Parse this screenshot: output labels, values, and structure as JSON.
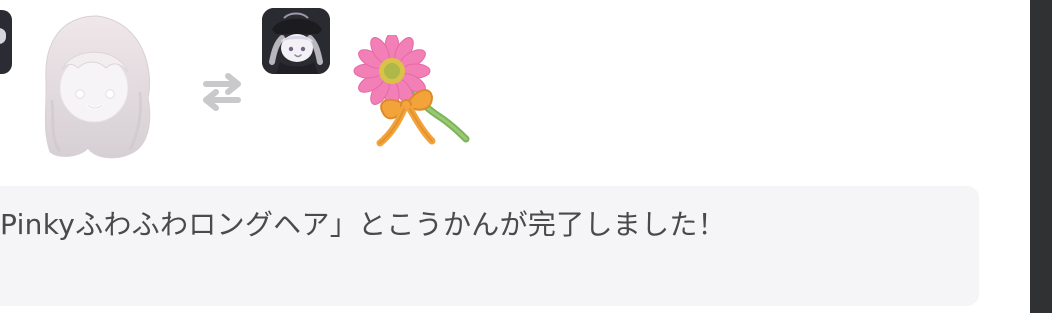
{
  "notification": {
    "message": "Pinkyふわふわロングヘア」とこうかんが完了しました！"
  },
  "icons": {
    "left_avatar": "user-avatar-icon",
    "hair": "long-wavy-hair-item-icon",
    "swap": "swap-arrows-icon",
    "small_avatar": "traded-avatar-icon",
    "flower": "flower-gift-icon"
  },
  "colors": {
    "message_bg": "#f5f5f7",
    "message_text": "#4a4a4a",
    "swap_icon": "#c9c9cc",
    "right_rail": "#2f3133"
  }
}
